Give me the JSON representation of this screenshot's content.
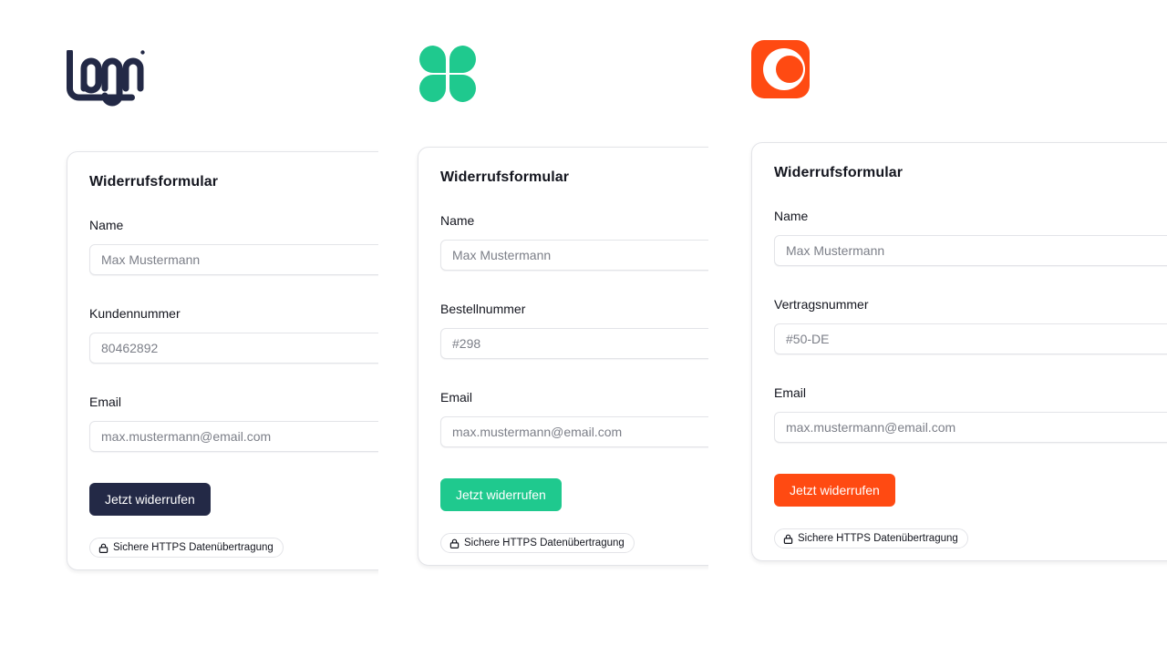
{
  "variants": [
    {
      "logo": {
        "icon": "logo-wordmark-icon",
        "color": "#232946"
      },
      "accent": "#232946",
      "form": {
        "title": "Widerrufsformular",
        "fields": [
          {
            "label": "Name",
            "placeholder": "Max Mustermann"
          },
          {
            "label": "Kundennummer",
            "placeholder": "80462892"
          },
          {
            "label": "Email",
            "placeholder": "max.mustermann@email.com"
          }
        ],
        "submit_label": "Jetzt widerrufen",
        "security_badge": "Sichere HTTPS Datenübertragung",
        "security_icon": "lock-icon"
      }
    },
    {
      "logo": {
        "icon": "clover-logo-icon",
        "color": "#1fc98e"
      },
      "accent": "#1fc98e",
      "form": {
        "title": "Widerrufsformular",
        "fields": [
          {
            "label": "Name",
            "placeholder": "Max Mustermann"
          },
          {
            "label": "Bestellnummer",
            "placeholder": "#298"
          },
          {
            "label": "Email",
            "placeholder": "max.mustermann@email.com"
          }
        ],
        "submit_label": "Jetzt widerrufen",
        "security_badge": "Sichere HTTPS Datenübertragung",
        "security_icon": "lock-icon"
      }
    },
    {
      "logo": {
        "icon": "ring-logo-icon",
        "color": "#ff4a12"
      },
      "accent": "#ff4a12",
      "form": {
        "title": "Widerrufsformular",
        "fields": [
          {
            "label": "Name",
            "placeholder": "Max Mustermann"
          },
          {
            "label": "Vertragsnummer",
            "placeholder": "#50-DE"
          },
          {
            "label": "Email",
            "placeholder": "max.mustermann@email.com"
          }
        ],
        "submit_label": "Jetzt widerrufen",
        "security_badge": "Sichere HTTPS Datenübertragung",
        "security_icon": "lock-icon"
      }
    }
  ]
}
